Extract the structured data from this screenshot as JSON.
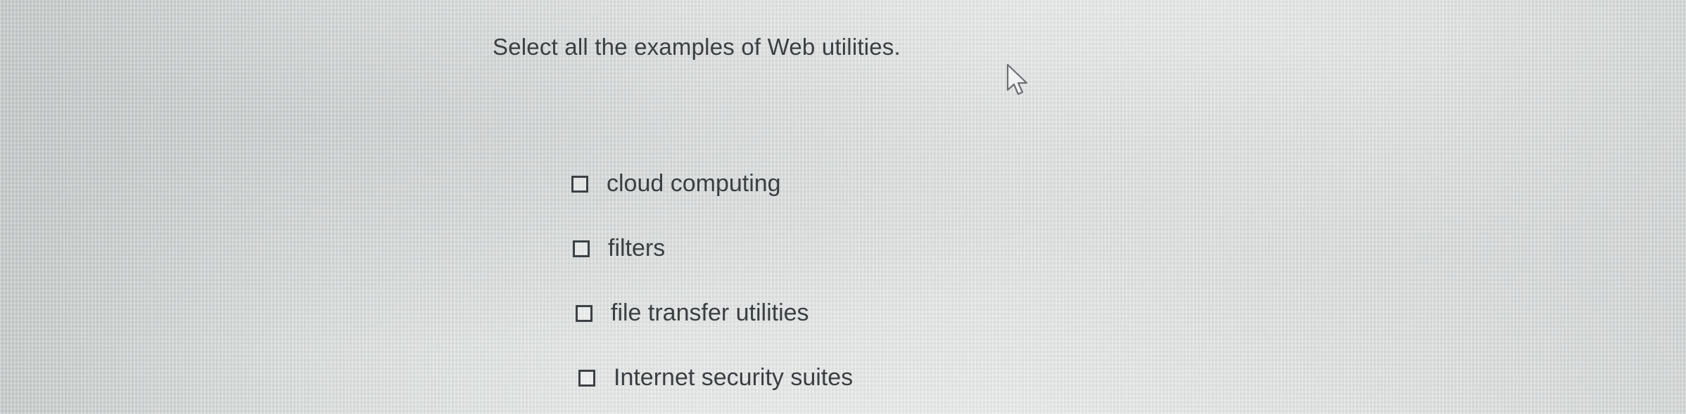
{
  "question": {
    "text": "Select all the examples of Web utilities."
  },
  "options": [
    {
      "label": "cloud computing",
      "checked": false
    },
    {
      "label": "filters",
      "checked": false
    },
    {
      "label": "file transfer utilities",
      "checked": false
    },
    {
      "label": "Internet security suites",
      "checked": false
    }
  ],
  "cursor": {
    "icon": "mouse-pointer-icon"
  },
  "colors": {
    "text": "#3b3f42",
    "checkbox_border": "#3d4144"
  }
}
